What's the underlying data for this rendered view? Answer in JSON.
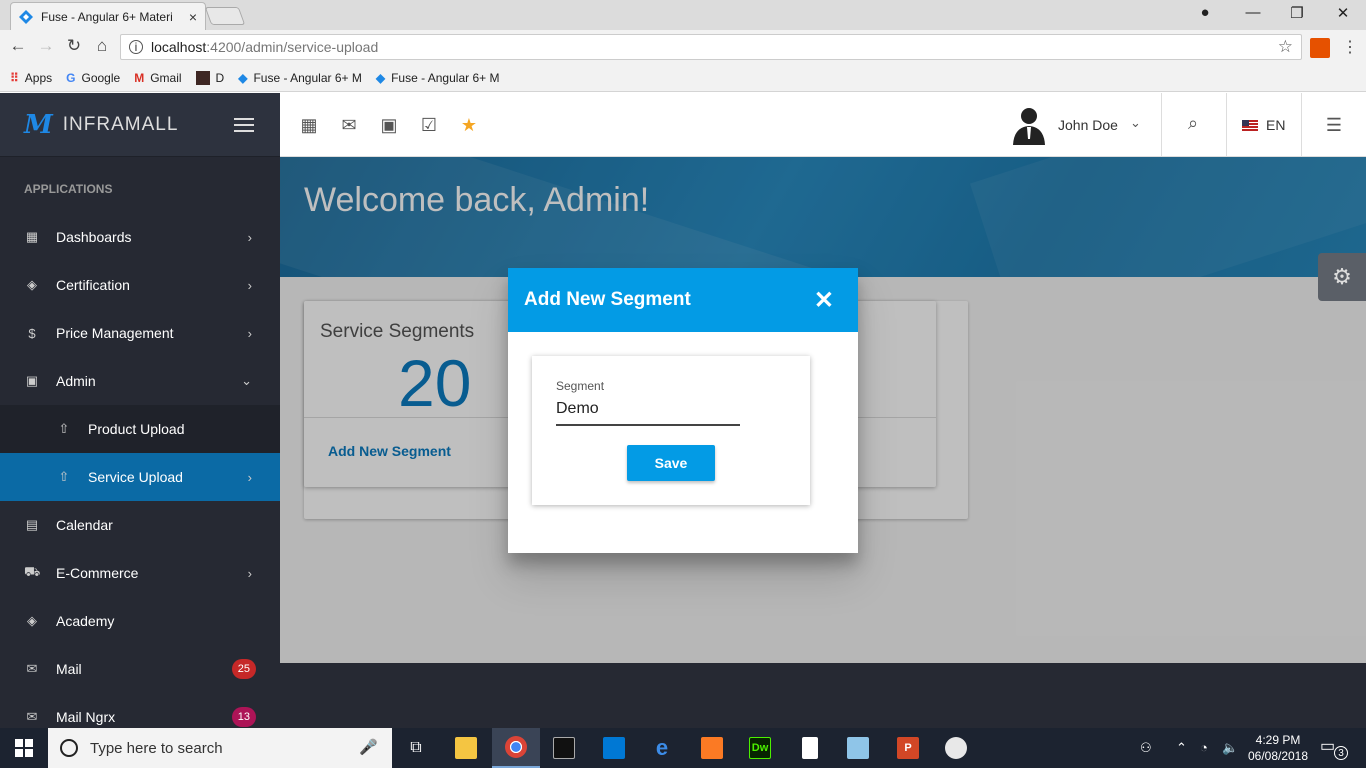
{
  "browser": {
    "tab_title": "Fuse - Angular 6+ Materi",
    "tab_close": "×",
    "url_host": "localhost",
    "url_path": ":4200/admin/service-upload",
    "bookmarks": [
      {
        "label": "Apps",
        "icon": "apps-icon"
      },
      {
        "label": "Google",
        "icon": "google-icon"
      },
      {
        "label": "Gmail",
        "icon": "gmail-icon"
      },
      {
        "label": "D",
        "icon": "bookmark-d-icon"
      },
      {
        "label": "Fuse - Angular 6+ M",
        "icon": "fuse-icon"
      },
      {
        "label": "Fuse - Angular 6+ M",
        "icon": "fuse-icon"
      }
    ]
  },
  "sidebar": {
    "brand": "INFRAMALL",
    "section": "APPLICATIONS",
    "items": [
      {
        "label": "Dashboards",
        "icon": "dashboard-icon",
        "chevron": "right"
      },
      {
        "label": "Certification",
        "icon": "school-icon",
        "chevron": "right"
      },
      {
        "label": "Price Management",
        "icon": "dollar-icon",
        "chevron": "right"
      },
      {
        "label": "Admin",
        "icon": "contact-icon",
        "chevron": "down"
      },
      {
        "label": "Product Upload",
        "icon": "upload-icon",
        "child": true
      },
      {
        "label": "Service Upload",
        "icon": "upload-icon",
        "child": true,
        "active": true,
        "chevron": "right"
      },
      {
        "label": "Calendar",
        "icon": "calendar-icon"
      },
      {
        "label": "E-Commerce",
        "icon": "cart-icon",
        "chevron": "right"
      },
      {
        "label": "Academy",
        "icon": "school-icon"
      },
      {
        "label": "Mail",
        "icon": "mail-icon",
        "badge": "25",
        "badge_color": "#c62828"
      },
      {
        "label": "Mail Ngrx",
        "icon": "mail-icon",
        "badge": "13",
        "badge_color": "#ad1457"
      }
    ]
  },
  "toolbar": {
    "shortcuts": [
      "calendar-icon",
      "mail-icon",
      "contact-icon",
      "check-box-icon",
      "star-icon"
    ],
    "user_name": "John Doe",
    "language": "EN"
  },
  "main": {
    "welcome": "Welcome back, Admin!",
    "card_title": "Service Segments",
    "card_value": "20",
    "card_link": "Add New Segment"
  },
  "dialog": {
    "title": "Add New Segment",
    "field_label": "Segment",
    "field_value": "Demo",
    "save_label": "Save"
  },
  "taskbar": {
    "search_placeholder": "Type here to search",
    "time": "4:29 PM",
    "date": "06/08/2018",
    "notifications": "3"
  },
  "colors": {
    "accent": "#039be5",
    "sidebar_bg": "#262933",
    "active_item": "#0b6aa5"
  }
}
